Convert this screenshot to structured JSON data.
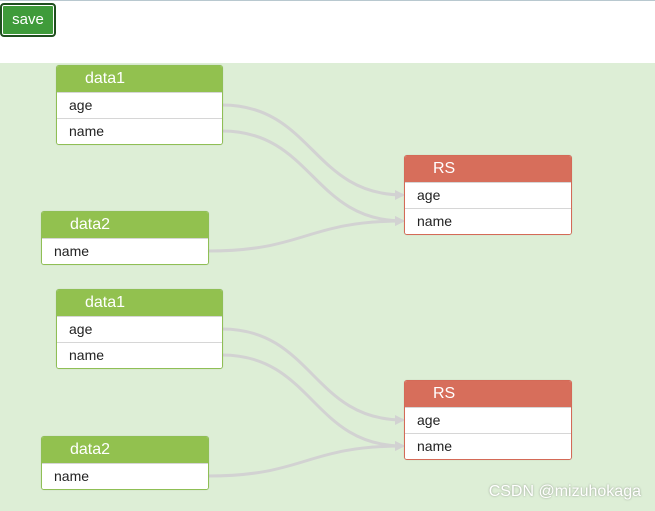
{
  "toolbar": {
    "save_label": "save"
  },
  "tables": {
    "g1_data1": {
      "title": "data1",
      "fields": [
        "age",
        "name"
      ]
    },
    "g1_data2": {
      "title": "data2",
      "fields": [
        "name"
      ]
    },
    "g1_rs": {
      "title": "RS",
      "fields": [
        "age",
        "name"
      ]
    },
    "g2_data1": {
      "title": "data1",
      "fields": [
        "age",
        "name"
      ]
    },
    "g2_data2": {
      "title": "data2",
      "fields": [
        "name"
      ]
    },
    "g2_rs": {
      "title": "RS",
      "fields": [
        "age",
        "name"
      ]
    }
  },
  "links": [
    {
      "from": "g1_data1.age",
      "to": "g1_rs.age"
    },
    {
      "from": "g1_data1.name",
      "to": "g1_rs.name"
    },
    {
      "from": "g1_data2.name",
      "to": "g1_rs.name"
    },
    {
      "from": "g2_data1.age",
      "to": "g2_rs.age"
    },
    {
      "from": "g2_data1.name",
      "to": "g2_rs.name"
    },
    {
      "from": "g2_data2.name",
      "to": "g2_rs.name"
    }
  ],
  "colors": {
    "canvas": "#ddeed6",
    "source_header": "#92c14f",
    "target_header": "#d76e5b",
    "link": "#d2d2d2",
    "save_button": "#3f9b3a"
  },
  "watermark": "CSDN @mizuhokaga"
}
